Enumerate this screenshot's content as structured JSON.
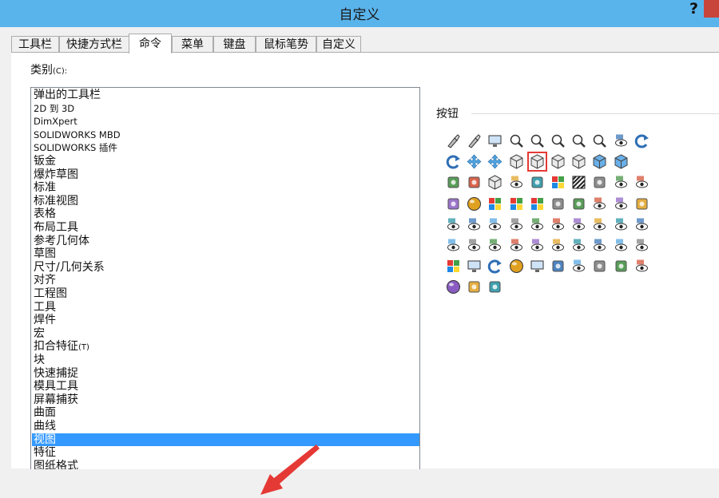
{
  "window": {
    "title": "自定义",
    "help_label": "?"
  },
  "tabs": [
    {
      "label": "工具栏"
    },
    {
      "label": "快捷方式栏"
    },
    {
      "label": "命令",
      "active": true
    },
    {
      "label": "菜单"
    },
    {
      "label": "键盘"
    },
    {
      "label": "鼠标笔势"
    },
    {
      "label": "自定义"
    }
  ],
  "categories": {
    "label": "类别",
    "hotkey": "(C):",
    "items": [
      {
        "label": "弹出的工具栏"
      },
      {
        "label": "2D 到 3D"
      },
      {
        "label": "DimXpert"
      },
      {
        "label": "SOLIDWORKS MBD"
      },
      {
        "label": "SOLIDWORKS 插件"
      },
      {
        "label": "钣金"
      },
      {
        "label": "爆炸草图"
      },
      {
        "label": "标准"
      },
      {
        "label": "标准视图"
      },
      {
        "label": "表格"
      },
      {
        "label": "布局工具"
      },
      {
        "label": "参考几何体"
      },
      {
        "label": "草图"
      },
      {
        "label": "尺寸/几何关系"
      },
      {
        "label": "对齐"
      },
      {
        "label": "工程图"
      },
      {
        "label": "工具"
      },
      {
        "label": "焊件"
      },
      {
        "label": "宏"
      },
      {
        "label": "扣合特征",
        "suffix": "(T)"
      },
      {
        "label": "块"
      },
      {
        "label": "快速捕捉"
      },
      {
        "label": "模具工具"
      },
      {
        "label": "屏幕捕获"
      },
      {
        "label": "曲面"
      },
      {
        "label": "曲线"
      },
      {
        "label": "视图",
        "selected": true
      },
      {
        "label": "特征"
      },
      {
        "label": "图纸格式"
      }
    ]
  },
  "buttons": {
    "label": "按钮",
    "highlighted_index": 14,
    "icons": [
      "flashlight-icon",
      "flashlight-arrow-icon",
      "monitor-icon",
      "zoom-in-out-icon",
      "zoom-to-fit-icon",
      "zoom-area-icon",
      "zoom-in-icon",
      "zoom-selection-icon",
      "view-orientation-cube-icon",
      "rotate-view-icon",
      "roll-view-icon",
      "pan-icon",
      "move-arrows-icon",
      "cube-shaded-icon",
      "cube-wireframe-icon",
      "cube-hidden-lines-icon",
      "cube-outline-icon",
      "cube-blue-icon",
      "cube-light-blue-icon",
      "section-view-icon",
      "perspective-icon",
      "cube-gray-icon",
      "view-gray-icon",
      "camera-view-icon",
      "rainbow-icon",
      "zebra-stripes-icon",
      "curvature-icon",
      "view-zoom-icon",
      "view-search-icon",
      "scene-icon",
      "sphere-appearance-icon",
      "decal-icon",
      "color-palette-icon",
      "scene-colors-icon",
      "appearance-paint-icon",
      "edit-appearance-icon",
      "view-eye-icon",
      "hide-show-icon",
      "display-pane-icon",
      "view-axes-icon",
      "view-planes-icon",
      "view-points-icon",
      "view-coordinates-icon",
      "view-origins-icon",
      "view-curves-icon",
      "view-sketches-icon",
      "view-grid-icon",
      "view-3d-sketch-icon",
      "view-dimensions-icon",
      "view-annotations-icon",
      "view-d1-icon",
      "view-temporary-axes-icon",
      "view-routing-icon",
      "view-lights-icon",
      "view-cameras-icon",
      "view-decals-icon",
      "view-weld-icon",
      "view-parts-icon",
      "view-sphere-icon",
      "render-icon",
      "print-icon",
      "rotate-about-icon",
      "capture-icon",
      "screen-capture-icon",
      "cloud-icon",
      "view-markup-icon",
      "abc-view-icon",
      "abc-settings-icon",
      "view-clip-icon",
      "ambient-occlusion-icon",
      "display-states-icon",
      "selection-box-icon"
    ]
  }
}
